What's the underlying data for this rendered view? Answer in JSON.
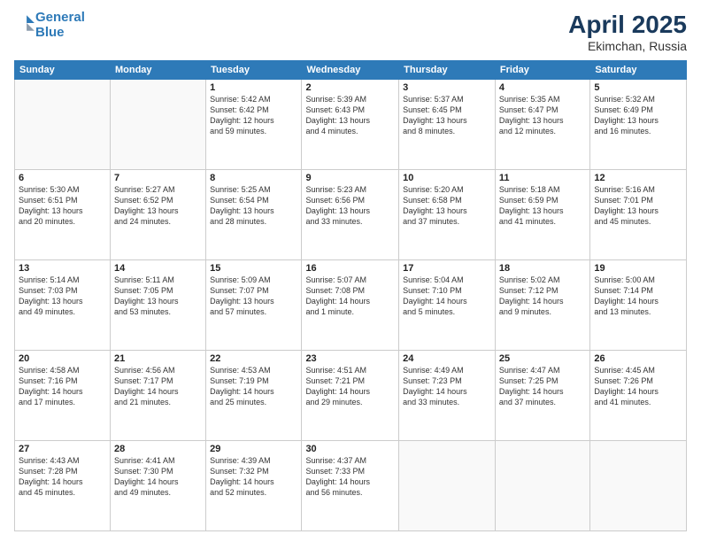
{
  "header": {
    "logo_line1": "General",
    "logo_line2": "Blue",
    "month": "April 2025",
    "location": "Ekimchan, Russia"
  },
  "days_of_week": [
    "Sunday",
    "Monday",
    "Tuesday",
    "Wednesday",
    "Thursday",
    "Friday",
    "Saturday"
  ],
  "weeks": [
    [
      {
        "day": "",
        "info": ""
      },
      {
        "day": "",
        "info": ""
      },
      {
        "day": "1",
        "info": "Sunrise: 5:42 AM\nSunset: 6:42 PM\nDaylight: 12 hours\nand 59 minutes."
      },
      {
        "day": "2",
        "info": "Sunrise: 5:39 AM\nSunset: 6:43 PM\nDaylight: 13 hours\nand 4 minutes."
      },
      {
        "day": "3",
        "info": "Sunrise: 5:37 AM\nSunset: 6:45 PM\nDaylight: 13 hours\nand 8 minutes."
      },
      {
        "day": "4",
        "info": "Sunrise: 5:35 AM\nSunset: 6:47 PM\nDaylight: 13 hours\nand 12 minutes."
      },
      {
        "day": "5",
        "info": "Sunrise: 5:32 AM\nSunset: 6:49 PM\nDaylight: 13 hours\nand 16 minutes."
      }
    ],
    [
      {
        "day": "6",
        "info": "Sunrise: 5:30 AM\nSunset: 6:51 PM\nDaylight: 13 hours\nand 20 minutes."
      },
      {
        "day": "7",
        "info": "Sunrise: 5:27 AM\nSunset: 6:52 PM\nDaylight: 13 hours\nand 24 minutes."
      },
      {
        "day": "8",
        "info": "Sunrise: 5:25 AM\nSunset: 6:54 PM\nDaylight: 13 hours\nand 28 minutes."
      },
      {
        "day": "9",
        "info": "Sunrise: 5:23 AM\nSunset: 6:56 PM\nDaylight: 13 hours\nand 33 minutes."
      },
      {
        "day": "10",
        "info": "Sunrise: 5:20 AM\nSunset: 6:58 PM\nDaylight: 13 hours\nand 37 minutes."
      },
      {
        "day": "11",
        "info": "Sunrise: 5:18 AM\nSunset: 6:59 PM\nDaylight: 13 hours\nand 41 minutes."
      },
      {
        "day": "12",
        "info": "Sunrise: 5:16 AM\nSunset: 7:01 PM\nDaylight: 13 hours\nand 45 minutes."
      }
    ],
    [
      {
        "day": "13",
        "info": "Sunrise: 5:14 AM\nSunset: 7:03 PM\nDaylight: 13 hours\nand 49 minutes."
      },
      {
        "day": "14",
        "info": "Sunrise: 5:11 AM\nSunset: 7:05 PM\nDaylight: 13 hours\nand 53 minutes."
      },
      {
        "day": "15",
        "info": "Sunrise: 5:09 AM\nSunset: 7:07 PM\nDaylight: 13 hours\nand 57 minutes."
      },
      {
        "day": "16",
        "info": "Sunrise: 5:07 AM\nSunset: 7:08 PM\nDaylight: 14 hours\nand 1 minute."
      },
      {
        "day": "17",
        "info": "Sunrise: 5:04 AM\nSunset: 7:10 PM\nDaylight: 14 hours\nand 5 minutes."
      },
      {
        "day": "18",
        "info": "Sunrise: 5:02 AM\nSunset: 7:12 PM\nDaylight: 14 hours\nand 9 minutes."
      },
      {
        "day": "19",
        "info": "Sunrise: 5:00 AM\nSunset: 7:14 PM\nDaylight: 14 hours\nand 13 minutes."
      }
    ],
    [
      {
        "day": "20",
        "info": "Sunrise: 4:58 AM\nSunset: 7:16 PM\nDaylight: 14 hours\nand 17 minutes."
      },
      {
        "day": "21",
        "info": "Sunrise: 4:56 AM\nSunset: 7:17 PM\nDaylight: 14 hours\nand 21 minutes."
      },
      {
        "day": "22",
        "info": "Sunrise: 4:53 AM\nSunset: 7:19 PM\nDaylight: 14 hours\nand 25 minutes."
      },
      {
        "day": "23",
        "info": "Sunrise: 4:51 AM\nSunset: 7:21 PM\nDaylight: 14 hours\nand 29 minutes."
      },
      {
        "day": "24",
        "info": "Sunrise: 4:49 AM\nSunset: 7:23 PM\nDaylight: 14 hours\nand 33 minutes."
      },
      {
        "day": "25",
        "info": "Sunrise: 4:47 AM\nSunset: 7:25 PM\nDaylight: 14 hours\nand 37 minutes."
      },
      {
        "day": "26",
        "info": "Sunrise: 4:45 AM\nSunset: 7:26 PM\nDaylight: 14 hours\nand 41 minutes."
      }
    ],
    [
      {
        "day": "27",
        "info": "Sunrise: 4:43 AM\nSunset: 7:28 PM\nDaylight: 14 hours\nand 45 minutes."
      },
      {
        "day": "28",
        "info": "Sunrise: 4:41 AM\nSunset: 7:30 PM\nDaylight: 14 hours\nand 49 minutes."
      },
      {
        "day": "29",
        "info": "Sunrise: 4:39 AM\nSunset: 7:32 PM\nDaylight: 14 hours\nand 52 minutes."
      },
      {
        "day": "30",
        "info": "Sunrise: 4:37 AM\nSunset: 7:33 PM\nDaylight: 14 hours\nand 56 minutes."
      },
      {
        "day": "",
        "info": ""
      },
      {
        "day": "",
        "info": ""
      },
      {
        "day": "",
        "info": ""
      }
    ]
  ]
}
